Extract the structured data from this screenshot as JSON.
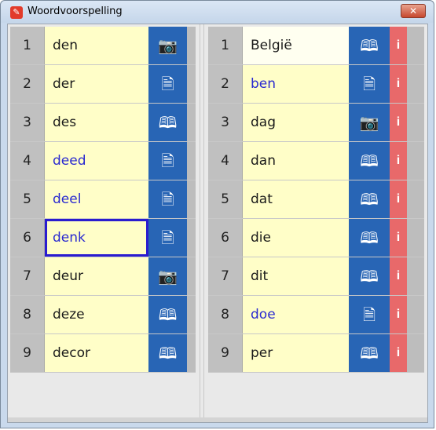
{
  "window": {
    "title": "Woordvoorspelling",
    "close_label": "✕",
    "app_icon_label": "✎"
  },
  "left_list": [
    {
      "num": "1",
      "word": "den",
      "icon": "camera-icon",
      "glyph": "📷",
      "blue": false
    },
    {
      "num": "2",
      "word": "der",
      "icon": "document-icon",
      "glyph": "🗎",
      "blue": false
    },
    {
      "num": "3",
      "word": "des",
      "icon": "book-icon",
      "glyph": "🕮",
      "blue": false
    },
    {
      "num": "4",
      "word": "deed",
      "icon": "document-icon",
      "glyph": "🗎",
      "blue": true
    },
    {
      "num": "5",
      "word": "deel",
      "icon": "document-icon",
      "glyph": "🗎",
      "blue": true
    },
    {
      "num": "6",
      "word": "denk",
      "icon": "document-icon",
      "glyph": "🗎",
      "blue": true,
      "selected": true
    },
    {
      "num": "7",
      "word": "deur",
      "icon": "camera-icon",
      "glyph": "📷",
      "blue": false
    },
    {
      "num": "8",
      "word": "deze",
      "icon": "book-icon",
      "glyph": "🕮",
      "blue": false
    },
    {
      "num": "9",
      "word": "decor",
      "icon": "book-icon",
      "glyph": "🕮",
      "blue": false
    }
  ],
  "right_list": [
    {
      "num": "1",
      "word": "België",
      "icon": "book-icon",
      "glyph": "🕮",
      "blue": false,
      "light": true
    },
    {
      "num": "2",
      "word": "ben",
      "icon": "document-icon",
      "glyph": "🗎",
      "blue": true
    },
    {
      "num": "3",
      "word": "dag",
      "icon": "camera-icon",
      "glyph": "📷",
      "blue": false
    },
    {
      "num": "4",
      "word": "dan",
      "icon": "book-icon",
      "glyph": "🕮",
      "blue": false
    },
    {
      "num": "5",
      "word": "dat",
      "icon": "book-icon",
      "glyph": "🕮",
      "blue": false
    },
    {
      "num": "6",
      "word": "die",
      "icon": "book-icon",
      "glyph": "🕮",
      "blue": false
    },
    {
      "num": "7",
      "word": "dit",
      "icon": "book-icon",
      "glyph": "🕮",
      "blue": false
    },
    {
      "num": "8",
      "word": "doe",
      "icon": "document-icon",
      "glyph": "🗎",
      "blue": true
    },
    {
      "num": "9",
      "word": "per",
      "icon": "book-icon",
      "glyph": "🕮",
      "blue": false
    }
  ],
  "info_label": "i",
  "colors": {
    "icon_bg": "#2865b5",
    "info_bg": "#e8696a",
    "word_bg": "#fffec8",
    "blue_word": "#2a2ad0"
  }
}
